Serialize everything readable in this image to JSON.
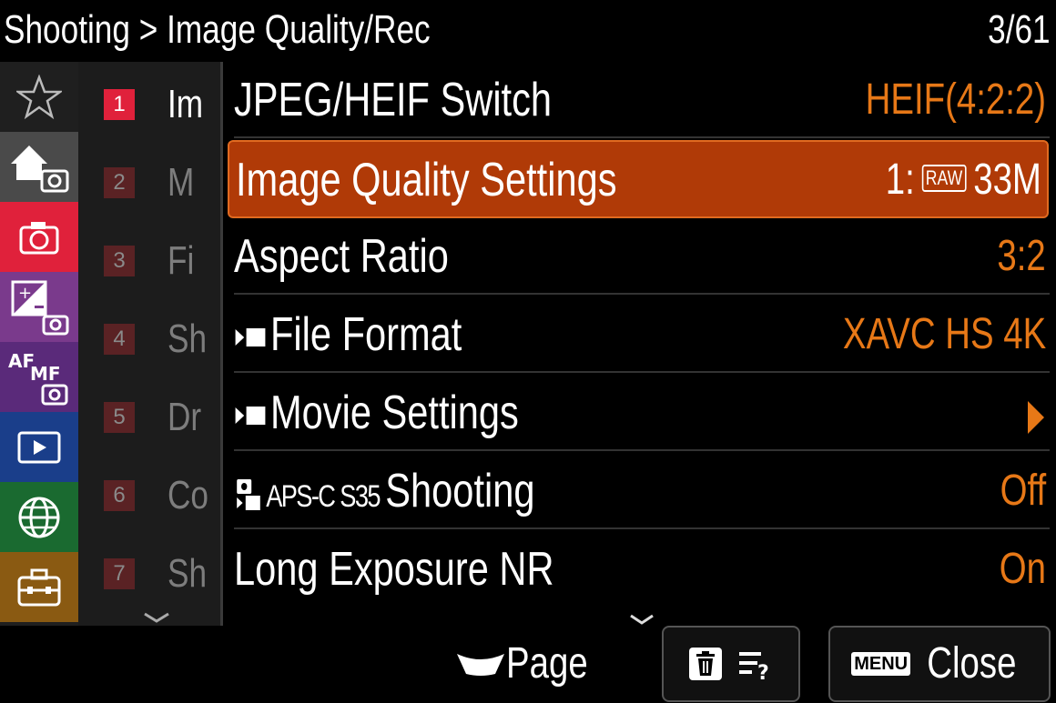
{
  "header": {
    "breadcrumb": "Shooting > Image Quality/Rec",
    "page_indicator": "3/61"
  },
  "categories": [
    {
      "name": "favorites",
      "icon": "star-outline-icon"
    },
    {
      "name": "main",
      "icon": "home-camera-icon",
      "selected": true
    },
    {
      "name": "shooting",
      "icon": "camera-icon",
      "color": "#e0213b"
    },
    {
      "name": "exposure-color",
      "icon": "exposure-comp-icon",
      "color": "#7a3a8c"
    },
    {
      "name": "focus",
      "icon": "af-mf-icon",
      "color": "#5a2a7a"
    },
    {
      "name": "playback",
      "icon": "playback-icon",
      "color": "#1a3e8a"
    },
    {
      "name": "network",
      "icon": "globe-icon",
      "color": "#1a6a30"
    },
    {
      "name": "setup",
      "icon": "toolbox-icon",
      "color": "#8a5a12"
    }
  ],
  "groups": [
    {
      "num": "1",
      "label": "Im",
      "active": true
    },
    {
      "num": "2",
      "label": "M"
    },
    {
      "num": "3",
      "label": "Fi"
    },
    {
      "num": "4",
      "label": "Sh"
    },
    {
      "num": "5",
      "label": "Dr"
    },
    {
      "num": "6",
      "label": "Co"
    },
    {
      "num": "7",
      "label": "Sh"
    }
  ],
  "menu": [
    {
      "label": "JPEG/HEIF Switch",
      "value": "HEIF(4:2:2)"
    },
    {
      "label": "Image Quality Settings",
      "value_prefix": "1:",
      "value_badge": "RAW",
      "value": "33M",
      "selected": true
    },
    {
      "label": "Aspect Ratio",
      "value": "3:2"
    },
    {
      "label": "File Format",
      "value": "XAVC HS 4K",
      "movie": true
    },
    {
      "label": "Movie Settings",
      "value": "",
      "movie": true,
      "arrow": true
    },
    {
      "label_prefix": "APS-C S35",
      "label": "Shooting",
      "value": "Off",
      "apsc": true
    },
    {
      "label": "Long Exposure NR",
      "value": "On"
    }
  ],
  "footer": {
    "page_label": "Page",
    "menu_badge": "MENU",
    "close_label": "Close"
  },
  "colors": {
    "accent_orange": "#e77817",
    "selected_row": "#b03a07",
    "group_active": "#e0213b"
  }
}
